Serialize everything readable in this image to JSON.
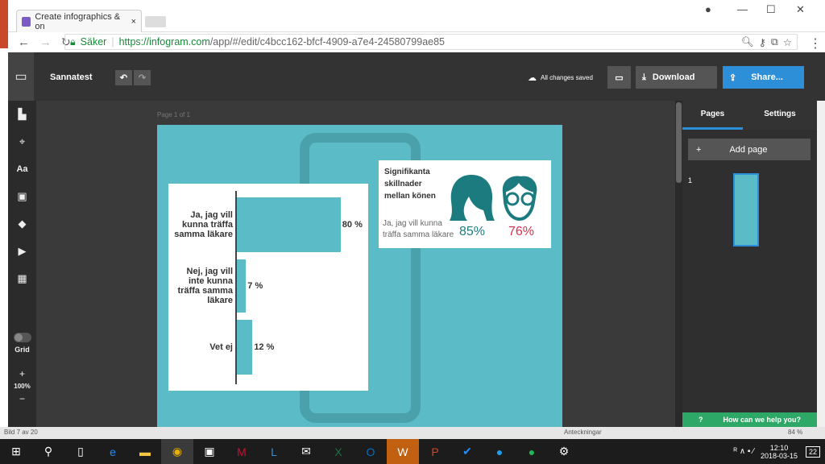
{
  "browser": {
    "tab_title": "Create infographics & on",
    "url_secure": "Säker",
    "url_host": "https://infogram.com",
    "url_path": "/app/#/edit/c4bcc162-bfcf-4909-a7e4-24580799ae85"
  },
  "app": {
    "project_name": "Sannatest",
    "save_status": "All changes saved",
    "download_label": "Download",
    "share_label": "Share...",
    "page_indicator": "Page 1 of 1",
    "grid_label": "Grid",
    "zoom": "100%"
  },
  "right_panel": {
    "tabs": [
      "Pages",
      "Settings"
    ],
    "add_page": "Add page",
    "page_number": "1",
    "help": "How can we help you?"
  },
  "chart_data": {
    "type": "bar",
    "orientation": "horizontal",
    "categories": [
      "Ja, jag vill kunna träffa samma läkare",
      "Nej, jag vill inte kunna träffa samma läkare",
      "Vet ej"
    ],
    "values": [
      80,
      7,
      12
    ],
    "value_labels": [
      "80 %",
      "7 %",
      "12 %"
    ],
    "xlim": [
      0,
      100
    ],
    "bar_color": "#5bbcc7"
  },
  "stat_card": {
    "title": "Signifikanta skillnader mellan könen",
    "subtitle": "Ja, jag vill kunna träffa samma läkare",
    "female_value": "85%",
    "male_value": "76%",
    "female_color": "#1c7b7f",
    "male_color": "#d9304a"
  },
  "ppt_status": {
    "slide": "Bild 7 av 20",
    "notes": "Anteckningar",
    "zoom": "84 %"
  },
  "taskbar": {
    "time": "12:10",
    "date": "2018-03-15",
    "notifications": "22"
  }
}
